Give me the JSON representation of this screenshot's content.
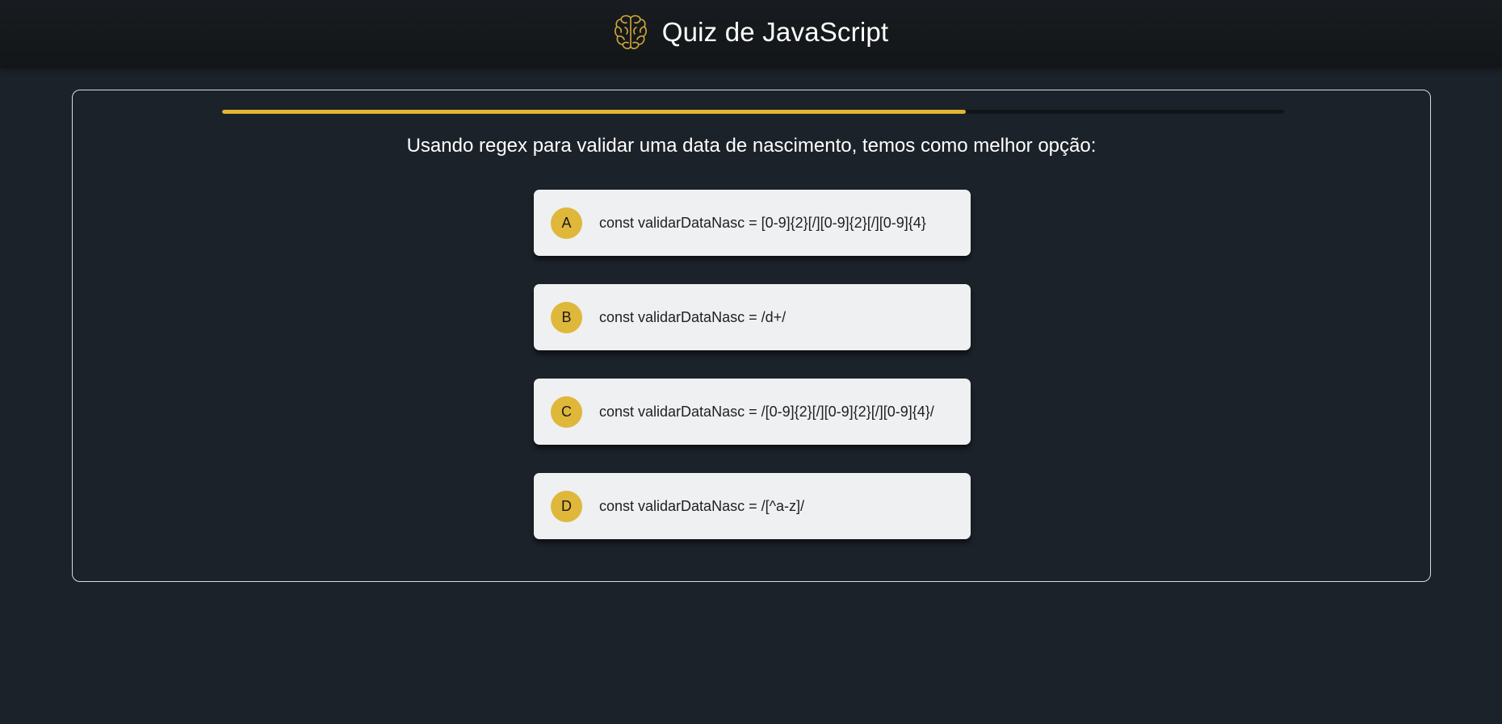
{
  "header": {
    "title": "Quiz de JavaScript",
    "icon": "brain-icon",
    "icon_color": "#d4a93a"
  },
  "progress": {
    "fraction": 0.7,
    "color": "#e0b634"
  },
  "question": {
    "text": "Usando regex para validar uma data de nascimento, temos como melhor opção:"
  },
  "options": [
    {
      "letter": "A",
      "text": "const validarDataNasc = [0-9]{2}[/][0-9]{2}[/][0-9]{4}"
    },
    {
      "letter": "B",
      "text": "const validarDataNasc = /d+/"
    },
    {
      "letter": "C",
      "text": "const validarDataNasc = /[0-9]{2}[/][0-9]{2}[/][0-9]{4}/"
    },
    {
      "letter": "D",
      "text": "const validarDataNasc = /[^a-z]/"
    }
  ],
  "colors": {
    "background": "#1c222a",
    "accent": "#dfb73a",
    "option_background": "#eef0f1"
  }
}
